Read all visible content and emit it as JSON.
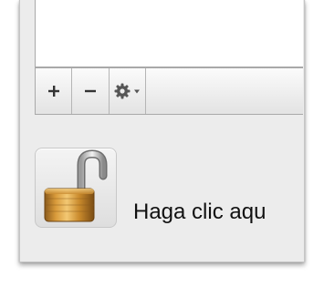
{
  "list": {
    "rows": []
  },
  "toolbar": {
    "add_icon": "plus-icon",
    "remove_icon": "minus-icon",
    "action_icon": "gear-icon"
  },
  "lock": {
    "icon": "unlocked-padlock-icon",
    "label": "Haga clic aqu"
  }
}
